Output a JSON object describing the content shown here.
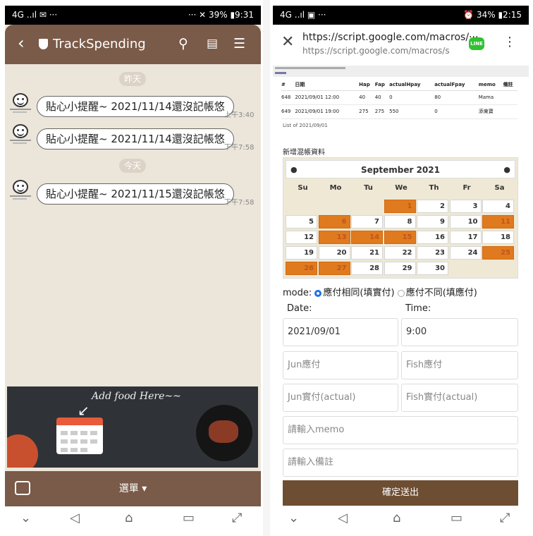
{
  "left": {
    "status": {
      "left": "4G ..ıl ✉ ···",
      "right": "··· ✕ 39% ▮9:31"
    },
    "header": {
      "title": "TrackSpending"
    },
    "day_labels": [
      "昨天",
      "今天"
    ],
    "messages": [
      {
        "text": "貼心小提醒~ 2021/11/14還沒記帳悠",
        "time": "上午3:40"
      },
      {
        "text": "貼心小提醒~ 2021/11/14還沒記帳悠",
        "time": "下午7:58"
      },
      {
        "text": "貼心小提醒~ 2021/11/15還沒記帳悠",
        "time": "下午7:58"
      }
    ],
    "banner": {
      "text": "Add food Here~~"
    },
    "footer": {
      "menu_label": "選單 ▾"
    }
  },
  "right": {
    "status": {
      "left": "4G ..ıl ▣ ···",
      "right": "⏰ 34% ▮2:15"
    },
    "address": {
      "url": "https://script.google.com/macros/···",
      "url_sub": "https://script.google.com/macros/s",
      "line_label": "LINE"
    },
    "table": {
      "headers": [
        "#",
        "日期",
        "Hap",
        "Fap",
        "actualHpay",
        "actualFpay",
        "memo",
        "備註"
      ],
      "rows": [
        [
          "648",
          "2021/09/01 12:00",
          "40",
          "40",
          "0",
          "80",
          "Mama",
          ""
        ],
        [
          "649",
          "2021/09/01 19:00",
          "275",
          "275",
          "550",
          "0",
          "添東寶",
          ""
        ]
      ]
    },
    "list_of": "List of 2021/09/01",
    "section_title": "新增混帳資料",
    "calendar": {
      "month_label": "September 2021",
      "weekdays": [
        "Su",
        "Mo",
        "Tu",
        "We",
        "Th",
        "Fr",
        "Sa"
      ],
      "first_weekday": 3,
      "days_in_month": 30,
      "highlighted": [
        1,
        6,
        11,
        13,
        14,
        15,
        25,
        26,
        27
      ]
    },
    "mode": {
      "label": "mode:",
      "option1": "應付相同(填實付)",
      "option2": "應付不同(填應付)"
    },
    "form": {
      "date_label": "Date:",
      "time_label": "Time:",
      "date_value": "2021/09/01",
      "time_value": "9:00",
      "jun_due": "Jun應付",
      "fish_due": "Fish應付",
      "jun_actual": "Jun實付(actual)",
      "fish_actual": "Fish實付(actual)",
      "memo": "請輸入memo",
      "note": "請輸入備註",
      "submit": "確定送出"
    }
  },
  "navbar": {
    "icons": [
      "⌄",
      "◁",
      "⌂",
      "▭",
      "⤢"
    ]
  }
}
